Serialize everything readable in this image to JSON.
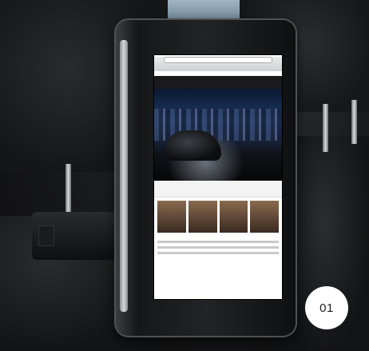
{
  "badge": {
    "number": "01"
  },
  "colors": {
    "badge_bg": "#ffffff",
    "badge_text": "#1c1c1c"
  }
}
